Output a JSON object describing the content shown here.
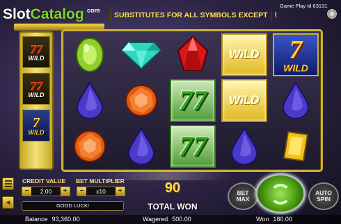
{
  "logo": {
    "slot": "Slot",
    "catalog": "Catalog",
    "com": "com"
  },
  "banner": {
    "text": "SUBSTITUTES FOR ALL SYMBOLS EXCEPT",
    "excl": "!"
  },
  "gameplay_id": "Game Play Id 63131",
  "side_column": [
    {
      "symbol": "77",
      "label": "WILD",
      "style": "gold"
    },
    {
      "symbol": "77",
      "label": "WILD",
      "style": "gold"
    },
    {
      "symbol": "7",
      "label": "WILD",
      "style": "blue"
    }
  ],
  "reels": [
    [
      {
        "symbol": "green-oval-gem"
      },
      {
        "symbol": "blue-drop-gem"
      },
      {
        "symbol": "orange-round-gem"
      }
    ],
    [
      {
        "symbol": "teal-diamond-gem"
      },
      {
        "symbol": "orange-round-gem"
      },
      {
        "symbol": "blue-drop-gem"
      }
    ],
    [
      {
        "symbol": "red-pointed-gem"
      },
      {
        "symbol": "green-77",
        "text": "77"
      },
      {
        "symbol": "green-77",
        "text": "77"
      }
    ],
    [
      {
        "symbol": "gold-wild",
        "text": "WILD"
      },
      {
        "symbol": "gold-wild",
        "text": "WILD"
      },
      {
        "symbol": "blue-drop-gem"
      }
    ],
    [
      {
        "symbol": "blue-7-wild",
        "text": "7",
        "sub": "WILD"
      },
      {
        "symbol": "blue-drop-gem"
      },
      {
        "symbol": "yellow-square-gem"
      }
    ]
  ],
  "controls": {
    "credit_value_label": "CREDIT VALUE",
    "credit_value": "2.00",
    "bet_multiplier_label": "BET MULTIPLIER",
    "bet_multiplier": "x10",
    "minus": "−",
    "plus": "+",
    "message": "GOOD LUCK!",
    "win_amount": "90",
    "total_won_label": "TOTAL WON",
    "bet_max_label": "BET MAX",
    "auto_spin_label": "AUTO SPIN"
  },
  "footer": {
    "balance_label": "Balance",
    "balance_value": "93,360.00",
    "wagered_label": "Wagered",
    "wagered_value": "500.00",
    "won_label": "Won",
    "won_value": "180.00"
  },
  "colors": {
    "accent_gold": "#ffe070",
    "win_green": "#35a21a",
    "frame_gold": "#c9b030"
  }
}
